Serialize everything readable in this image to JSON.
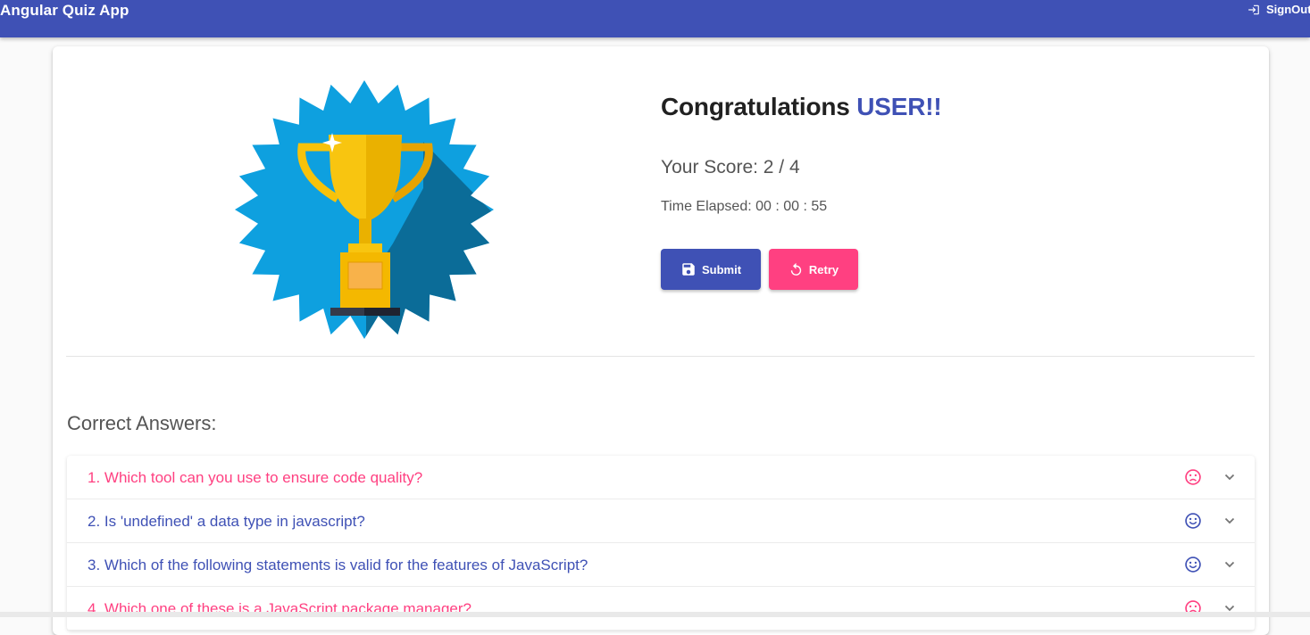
{
  "toolbar": {
    "title": "Angular Quiz App",
    "signout_label": "SignOut",
    "signout_icon": "login-icon",
    "color": "#3f51b5"
  },
  "result": {
    "congrats_prefix": "Congratulations ",
    "user_name": "USER!!",
    "score": "Your Score: 2 / 4",
    "time_elapsed": "Time Elapsed: 00 : 00 : 55",
    "badge_icon": "trophy-badge"
  },
  "actions": {
    "submit_label": "Submit",
    "submit_icon": "save-icon",
    "retry_label": "Retry",
    "retry_icon": "refresh-icon",
    "submit_color": "#3f51b5",
    "retry_color": "#ff4081"
  },
  "answers": {
    "heading": "Correct Answers:",
    "items": [
      {
        "question": "1. Which tool can you use to ensure code quality?",
        "correct": false,
        "icon": "sad-face-icon"
      },
      {
        "question": "2. Is 'undefined' a data type in javascript?",
        "correct": true,
        "icon": "smile-face-icon"
      },
      {
        "question": "3. Which of the following statements is valid for the features of JavaScript?",
        "correct": true,
        "icon": "smile-face-icon"
      },
      {
        "question": "4. Which one of these is a JavaScript package manager?",
        "correct": false,
        "icon": "sad-face-icon"
      }
    ]
  }
}
